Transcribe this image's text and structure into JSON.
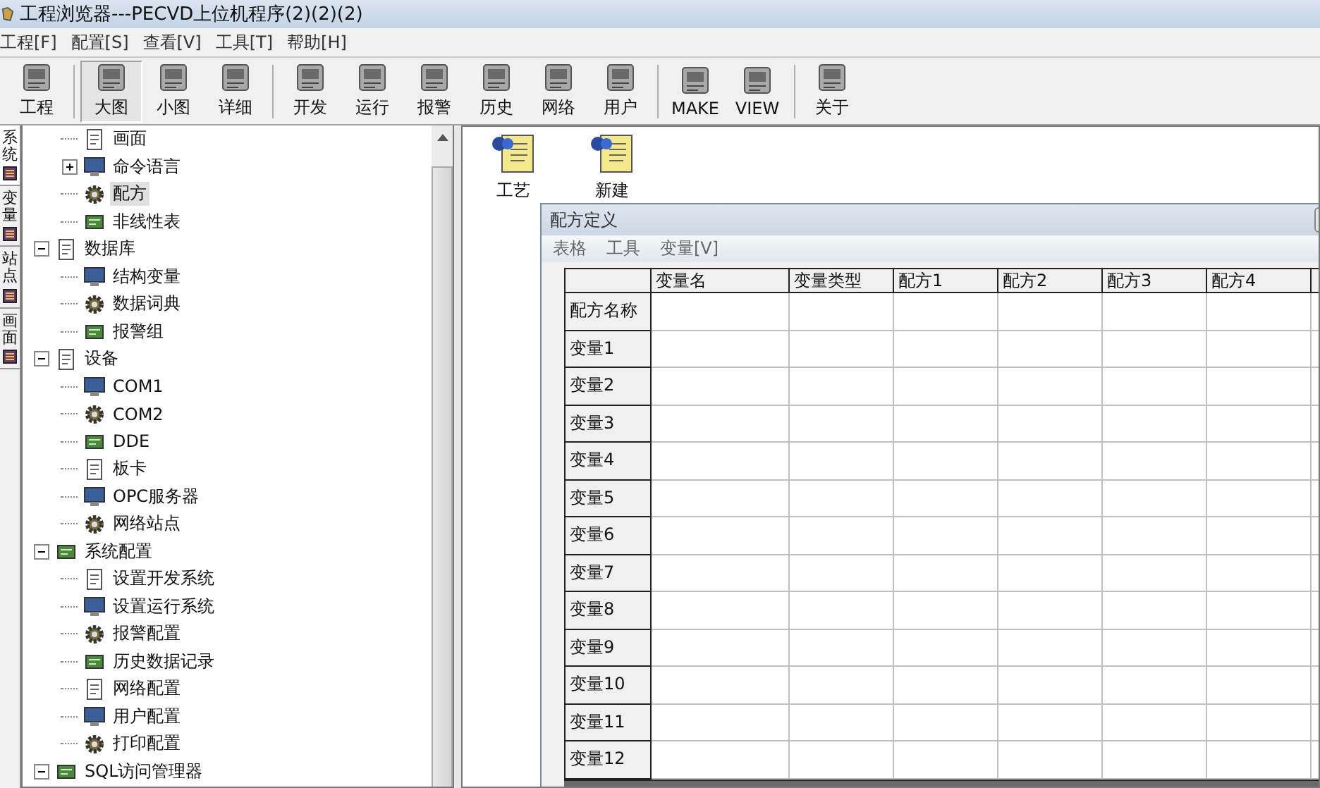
{
  "window": {
    "title": "工程浏览器---PECVD上位机程序(2)(2)(2)"
  },
  "menu": [
    "工程[F]",
    "配置[S]",
    "查看[V]",
    "工具[T]",
    "帮助[H]"
  ],
  "toolbar": {
    "groups": [
      [
        {
          "label": "工程",
          "selected": false
        }
      ],
      [
        {
          "label": "大图",
          "selected": true
        },
        {
          "label": "小图",
          "selected": false
        },
        {
          "label": "详细",
          "selected": false
        }
      ],
      [
        {
          "label": "开发",
          "selected": false
        },
        {
          "label": "运行",
          "selected": false
        },
        {
          "label": "报警",
          "selected": false
        },
        {
          "label": "历史",
          "selected": false
        },
        {
          "label": "网络",
          "selected": false
        },
        {
          "label": "用户",
          "selected": false
        }
      ],
      [
        {
          "label": "MAKE",
          "selected": false
        },
        {
          "label": "VIEW",
          "selected": false
        }
      ],
      [
        {
          "label": "关于",
          "selected": false
        }
      ]
    ]
  },
  "side_tabs": [
    {
      "label": "系统",
      "selected": true
    },
    {
      "label": "变量",
      "selected": false
    },
    {
      "label": "站点",
      "selected": false
    },
    {
      "label": "画面",
      "selected": false
    }
  ],
  "tree": {
    "partial_children": [
      {
        "label": "画面",
        "selected": false
      },
      {
        "label": "命令语言",
        "selected": false,
        "expanded": false
      },
      {
        "label": "配方",
        "selected": true
      },
      {
        "label": "非线性表",
        "selected": false
      }
    ],
    "items": [
      {
        "label": "数据库",
        "selected": false,
        "expanded": true,
        "children": [
          {
            "label": "结构变量",
            "selected": false
          },
          {
            "label": "数据词典",
            "selected": false
          },
          {
            "label": "报警组",
            "selected": false
          }
        ]
      },
      {
        "label": "设备",
        "selected": false,
        "expanded": true,
        "children": [
          {
            "label": "COM1",
            "selected": false
          },
          {
            "label": "COM2",
            "selected": false
          },
          {
            "label": "DDE",
            "selected": false
          },
          {
            "label": "板卡",
            "selected": false
          },
          {
            "label": "OPC服务器",
            "selected": false
          },
          {
            "label": "网络站点",
            "selected": false
          }
        ]
      },
      {
        "label": "系统配置",
        "selected": false,
        "expanded": true,
        "children": [
          {
            "label": "设置开发系统",
            "selected": false
          },
          {
            "label": "设置运行系统",
            "selected": false
          },
          {
            "label": "报警配置",
            "selected": false
          },
          {
            "label": "历史数据记录",
            "selected": false
          },
          {
            "label": "网络配置",
            "selected": false
          },
          {
            "label": "用户配置",
            "selected": false
          },
          {
            "label": "打印配置",
            "selected": false
          }
        ]
      },
      {
        "label": "SQL访问管理器",
        "selected": false,
        "expanded": true
      }
    ]
  },
  "files": [
    {
      "label": "工艺"
    },
    {
      "label": "新建"
    }
  ],
  "recipe_dialog": {
    "title": "配方定义",
    "menu": [
      "表格",
      "工具",
      "变量[V]"
    ],
    "table": {
      "columns": [
        "变量名",
        "变量类型",
        "配方1",
        "配方2",
        "配方3",
        "配方4"
      ],
      "rows": [
        "配方名称",
        "变量1",
        "变量2",
        "变量3",
        "变量4",
        "变量5",
        "变量6",
        "变量7",
        "变量8",
        "变量9",
        "变量10",
        "变量11",
        "变量12"
      ]
    }
  }
}
